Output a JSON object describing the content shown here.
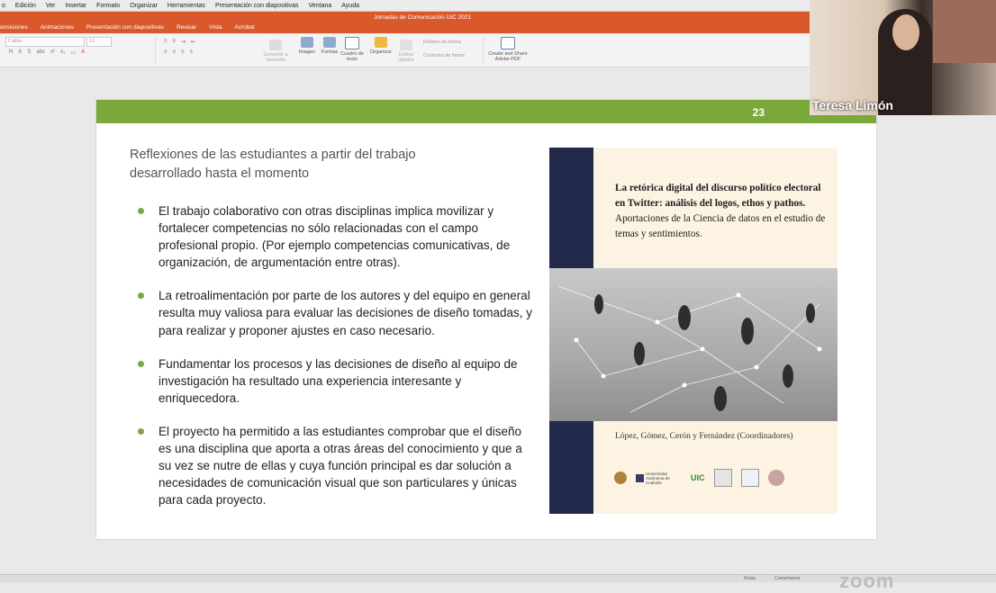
{
  "menu": [
    "o",
    "Edición",
    "Ver",
    "Insertar",
    "Formato",
    "Organizar",
    "Herramientas",
    "Presentación con diapositivas",
    "Ventana",
    "Ayuda"
  ],
  "window": {
    "title": "Jornadas de Comunicación UIC 2021",
    "tabs": [
      "ansiciones",
      "Animaciones",
      "Presentación con diapositivas",
      "Revisar",
      "Vista",
      "Acrobat"
    ]
  },
  "ribbon": {
    "font_name": "Calibri",
    "font_size": "12",
    "convert_label": "Convertir a SmartArt",
    "image_label": "Imagen",
    "shapes_label": "Formas",
    "textbox_label": "Cuadro de texto",
    "arrange_label": "Organizar",
    "quick_styles_label": "Estilos rápidos",
    "fill_label": "Relleno de forma",
    "outline_label": "Contorno de forma",
    "share_pdf_label": "Create and Share Adobe PDF"
  },
  "slide": {
    "number": "23",
    "heading": "Reflexiones de las estudiantes a partir del trabajo desarrollado hasta el momento",
    "bullets": [
      "El trabajo colaborativo con otras disciplinas implica movilizar y fortalecer competencias no sólo relacionadas con el campo profesional propio. (Por ejemplo competencias comunicativas, de organización, de argumentación entre otras).",
      "La retroalimentación por parte de los autores y del equipo en general resulta muy valiosa para evaluar las decisiones de diseño tomadas, y para realizar y proponer ajustes en caso necesario.",
      "Fundamentar los procesos y las decisiones de diseño al equipo de investigación ha resultado una experiencia interesante y enriquecedora.",
      "El proyecto ha permitido a las estudiantes comprobar que el diseño es una disciplina que aporta a otras áreas del conocimiento y que a su vez se nutre de ellas y cuya función principal es dar solución a necesidades de comunicación visual que son particulares y únicas para cada proyecto."
    ],
    "accent_color": "#7ba83a"
  },
  "cover": {
    "title_bold": "La retórica digital del discurso político electoral en Twitter: análisis del logos, ethos y pathos.",
    "title_rest": "Aportaciones de la Ciencia de datos en el estudio de temas y sentimientos.",
    "authors": "López, Gómez, Cerón y Fernández (Coordinadores)",
    "logos": [
      "Universidad Autónoma de Coahuila",
      "UIC"
    ]
  },
  "webcam": {
    "participant_name": "Teresa Limón"
  },
  "status": {
    "notes_label": "Notas",
    "comments_label": "Comentarios",
    "watermark": "zoom"
  }
}
